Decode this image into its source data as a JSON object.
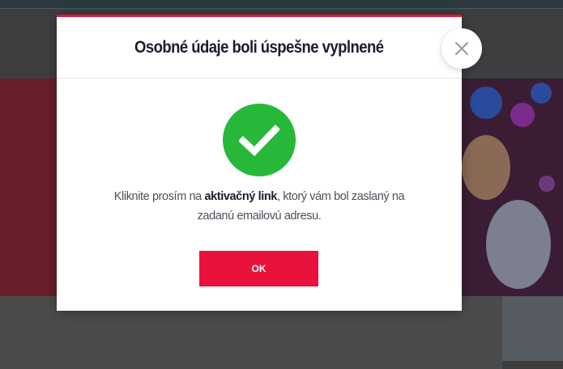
{
  "modal": {
    "title": "Osobné údaje boli úspešne vyplnené",
    "message_before": "Kliknite prosím na ",
    "message_link": "aktivačný link",
    "message_after": ", ktorý vám bol zaslaný na zadanú emailovú adresu.",
    "ok_label": "OK",
    "icons": {
      "status": "checkmark-icon",
      "close": "close-icon"
    }
  },
  "colors": {
    "accent": "#e8123d",
    "success": "#27b83a",
    "title_text": "#1c1c2e",
    "body_text": "#4e4e5a"
  }
}
